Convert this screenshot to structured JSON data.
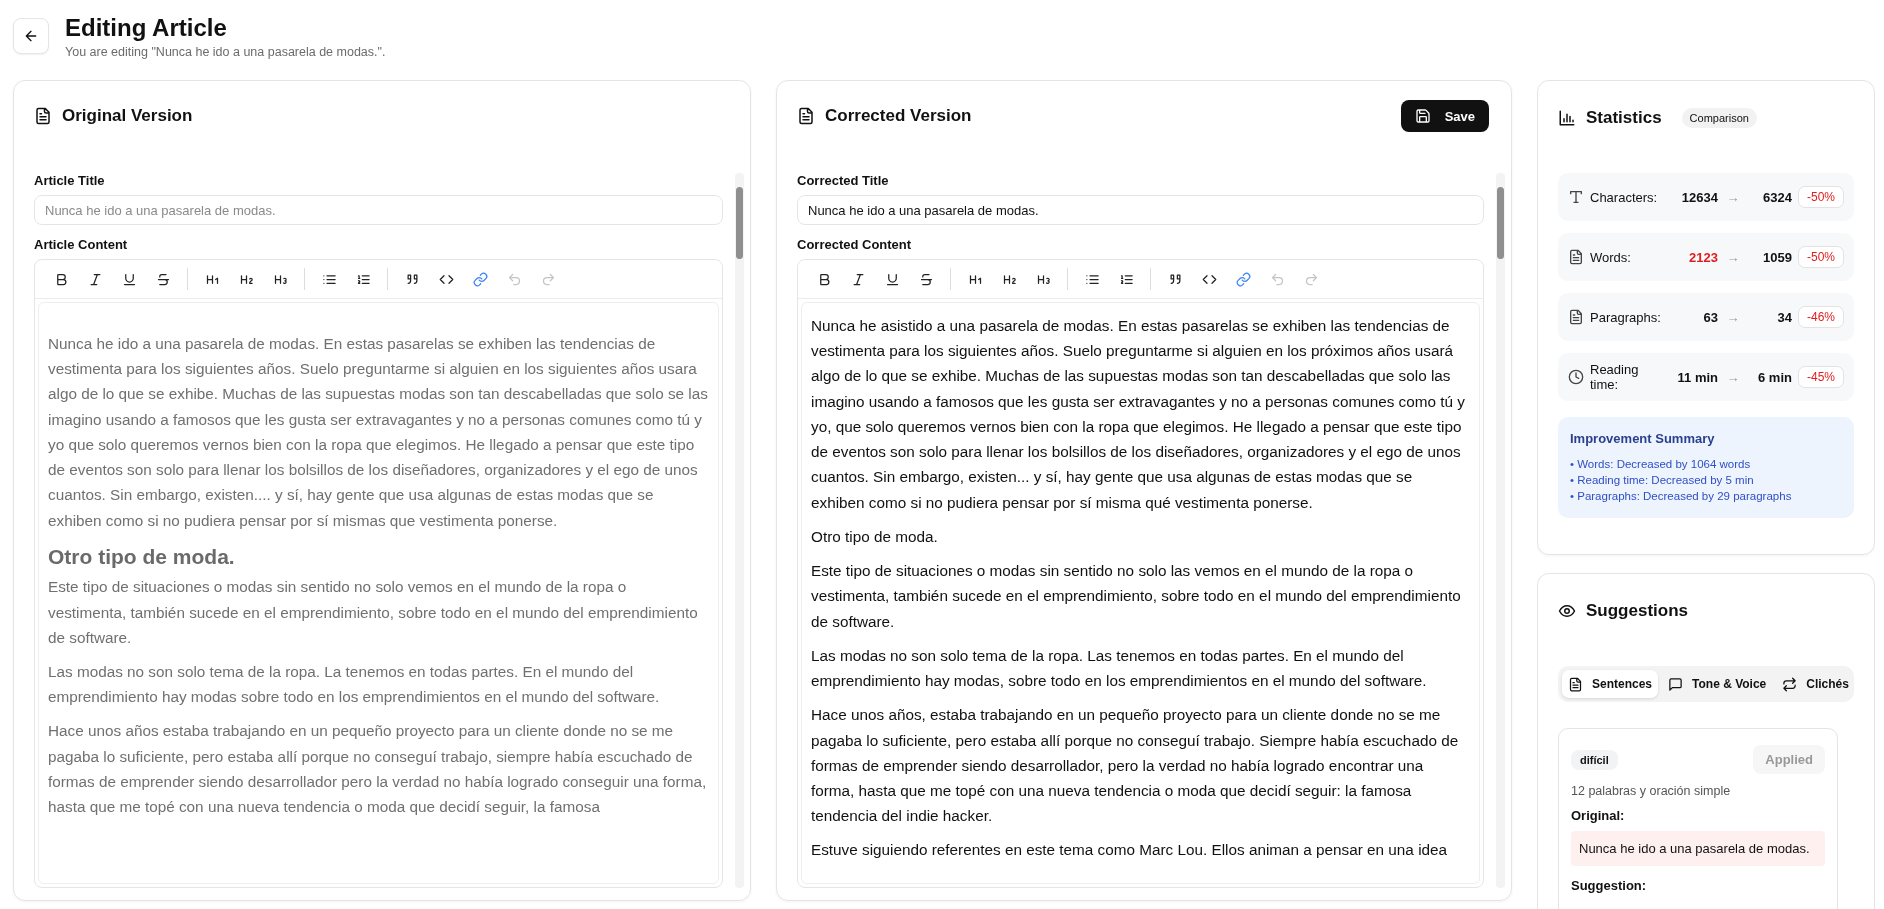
{
  "header": {
    "title": "Editing Article",
    "subtitle": "You are editing \"Nunca he ido a una pasarela de modas.\"."
  },
  "original": {
    "title": "Original Version",
    "disabled": true,
    "title_label": "Article Title",
    "title_value": "Nunca he ido a una pasarela de modas.",
    "content_label": "Article Content",
    "toolbar": [
      {
        "kind": "bold",
        "active": false,
        "disabled": false
      },
      {
        "kind": "italic",
        "active": false,
        "disabled": false
      },
      {
        "kind": "underline",
        "active": false,
        "disabled": false
      },
      {
        "kind": "strike",
        "active": false,
        "disabled": false
      },
      {
        "kind": "separator"
      },
      {
        "kind": "h1",
        "active": false,
        "disabled": false
      },
      {
        "kind": "h2",
        "active": false,
        "disabled": false
      },
      {
        "kind": "h3",
        "active": false,
        "disabled": false
      },
      {
        "kind": "separator"
      },
      {
        "kind": "bullets",
        "active": false,
        "disabled": false
      },
      {
        "kind": "numbers",
        "active": false,
        "disabled": false
      },
      {
        "kind": "separator"
      },
      {
        "kind": "quote",
        "active": false,
        "disabled": false
      },
      {
        "kind": "code",
        "active": false,
        "disabled": false
      },
      {
        "kind": "link",
        "active": true,
        "disabled": false
      },
      {
        "kind": "undo",
        "active": false,
        "disabled": true
      },
      {
        "kind": "redo",
        "active": false,
        "disabled": true
      }
    ],
    "content": [
      {
        "kind": "paragraph",
        "text": "Nunca he ido a una pasarela de modas. En estas pasarelas se exhiben las tendencias de vestimenta para los siguientes años. Suelo preguntarme si alguien en los siguientes años usara algo de lo que se exhibe. Muchas de las supuestas modas son tan descabelladas que solo se las imagino usando a famosos que les gusta ser extravagantes y no a personas comunes como tú y yo que solo queremos vernos bien con la ropa que elegimos. He llegado a pensar que este tipo de eventos son solo para llenar los bolsillos de los diseñadores, organizadores y el ego de unos cuantos. Sin embargo, existen.... y sí, hay gente que usa algunas de estas modas que se exhiben como si no pudiera pensar por sí mismas que vestimenta ponerse."
      },
      {
        "kind": "heading",
        "text": "Otro tipo de moda."
      },
      {
        "kind": "paragraph",
        "text": "Este tipo de situaciones o modas sin sentido no solo vemos en el mundo de la ropa o vestimenta, también sucede en el emprendimiento, sobre todo en el mundo del emprendimiento de software."
      },
      {
        "kind": "paragraph",
        "text": "Las modas no son solo tema de la ropa. La tenemos en todas partes. En el mundo del emprendimiento hay modas sobre todo en los emprendimientos en el mundo del software."
      },
      {
        "kind": "paragraph",
        "text": "Hace unos años estaba trabajando en un pequeño proyecto para un cliente donde no se me pagaba lo suficiente, pero estaba allí porque no conseguí trabajo, siempre había escuchado de formas de emprender siendo desarrollador pero la verdad no había logrado conseguir una forma, hasta que me topé con una nueva tendencia o moda que decidí seguir, la famosa"
      }
    ]
  },
  "corrected": {
    "title": "Corrected Version",
    "save_label": "Save",
    "disabled": false,
    "title_label": "Corrected Title",
    "title_value": "Nunca he ido a una pasarela de modas.",
    "content_label": "Corrected Content",
    "toolbar": [
      {
        "kind": "bold",
        "active": false,
        "disabled": false
      },
      {
        "kind": "italic",
        "active": false,
        "disabled": false
      },
      {
        "kind": "underline",
        "active": false,
        "disabled": false
      },
      {
        "kind": "strike",
        "active": false,
        "disabled": false
      },
      {
        "kind": "separator"
      },
      {
        "kind": "h1",
        "active": false,
        "disabled": false
      },
      {
        "kind": "h2",
        "active": false,
        "disabled": false
      },
      {
        "kind": "h3",
        "active": false,
        "disabled": false
      },
      {
        "kind": "separator"
      },
      {
        "kind": "bullets",
        "active": false,
        "disabled": false
      },
      {
        "kind": "numbers",
        "active": false,
        "disabled": false
      },
      {
        "kind": "separator"
      },
      {
        "kind": "quote",
        "active": false,
        "disabled": false
      },
      {
        "kind": "code",
        "active": false,
        "disabled": false
      },
      {
        "kind": "link",
        "active": true,
        "disabled": false
      },
      {
        "kind": "undo",
        "active": false,
        "disabled": true
      },
      {
        "kind": "redo",
        "active": false,
        "disabled": true
      }
    ],
    "content": [
      {
        "kind": "paragraph",
        "text": "Nunca he asistido a una pasarela de modas. En estas pasarelas se exhiben las tendencias de vestimenta para los siguientes años. Suelo preguntarme si alguien en los próximos años usará algo de lo que se exhibe. Muchas de las supuestas modas son tan descabelladas que solo las imagino usando a famosos que les gusta ser extravagantes y no a personas comunes como tú y yo, que solo queremos vernos bien con la ropa que elegimos. He llegado a pensar que este tipo de eventos son solo para llenar los bolsillos de los diseñadores, organizadores y el ego de unos cuantos. Sin embargo, existen... y sí, hay gente que usa algunas de estas modas que se exhiben como si no pudiera pensar por sí misma qué vestimenta ponerse."
      },
      {
        "kind": "paragraph",
        "text": "Otro tipo de moda."
      },
      {
        "kind": "paragraph",
        "text": "Este tipo de situaciones o modas sin sentido no solo las vemos en el mundo de la ropa o vestimenta, también sucede en el emprendimiento, sobre todo en el mundo del emprendimiento de software."
      },
      {
        "kind": "paragraph",
        "text": "Las modas no son solo tema de la ropa. Las tenemos en todas partes. En el mundo del emprendimiento hay modas, sobre todo en los emprendimientos en el mundo del software."
      },
      {
        "kind": "paragraph",
        "text": "Hace unos años, estaba trabajando en un pequeño proyecto para un cliente donde no se me pagaba lo suficiente, pero estaba allí porque no conseguí trabajo. Siempre había escuchado de formas de emprender siendo desarrollador, pero la verdad no había logrado encontrar una forma, hasta que me topé con una nueva tendencia o moda que decidí seguir: la famosa tendencia del indie hacker."
      },
      {
        "kind": "paragraph",
        "text": "Estuve siguiendo referentes en este tema como Marc Lou. Ellos animan a pensar en una idea"
      }
    ]
  },
  "statistics": {
    "title": "Statistics",
    "badge": "Comparison",
    "rows": [
      {
        "kind": "characters",
        "label": "Characters:",
        "before": "12634",
        "arrow": "→",
        "after": "6324",
        "change": "-50%",
        "before_highlight": false
      },
      {
        "kind": "words",
        "label": "Words:",
        "before": "2123",
        "arrow": "→",
        "after": "1059",
        "change": "-50%",
        "before_highlight": true
      },
      {
        "kind": "paragraphs",
        "label": "Paragraphs:",
        "before": "63",
        "arrow": "→",
        "after": "34",
        "change": "-46%",
        "before_highlight": false
      },
      {
        "kind": "reading_time",
        "label": "Reading time:",
        "before": "11 min",
        "arrow": "→",
        "after": "6 min",
        "change": "-45%",
        "before_highlight": false
      }
    ],
    "summary": {
      "title": "Improvement Summary",
      "items": [
        "• Words: Decreased by 1064 words",
        "• Reading time: Decreased by 5 min",
        "• Paragraphs: Decreased by 29 paragraphs"
      ]
    }
  },
  "suggestions": {
    "title": "Suggestions",
    "tabs": [
      {
        "kind": "sentences",
        "label": "Sentences",
        "selected": true
      },
      {
        "kind": "tone",
        "label": "Tone & Voice",
        "selected": false
      },
      {
        "kind": "cliches",
        "label": "Clichés",
        "selected": false
      }
    ],
    "cards": [
      {
        "tag": "difícil",
        "button": "Applied",
        "disabled": true,
        "note": "12 palabras y oración simple",
        "original_label": "Original:",
        "original_text": "Nunca he ido a una pasarela de modas.",
        "suggestion_label": "Suggestion:"
      }
    ]
  }
}
